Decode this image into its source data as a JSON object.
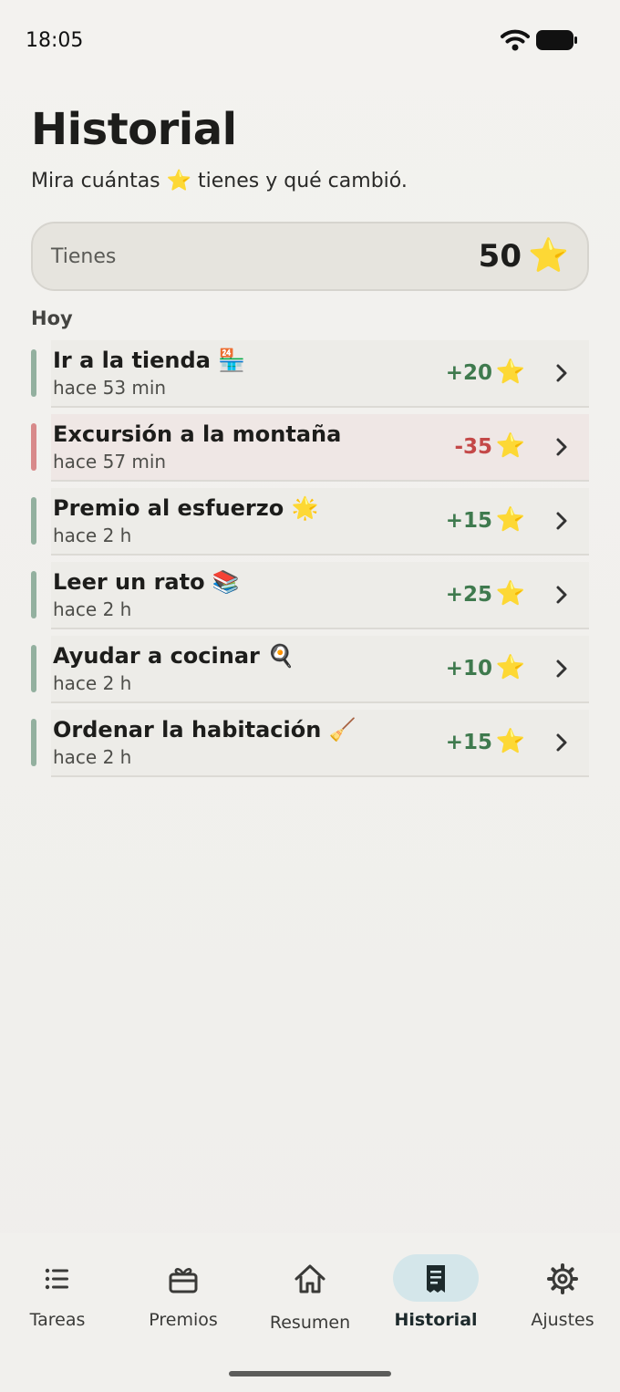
{
  "status": {
    "time": "18:05"
  },
  "header": {
    "title": "Historial",
    "subtitle": "Mira cuántas ⭐ tienes y qué cambió."
  },
  "balance": {
    "label": "Tienes",
    "value": "50",
    "star": "⭐"
  },
  "section": {
    "label": "Hoy"
  },
  "entries": [
    {
      "name": "Ir a la tienda 🏪",
      "time": "hace 53 min",
      "amount": "+20",
      "star": "⭐",
      "type": "positive"
    },
    {
      "name": "Excursión a la montaña",
      "time": "hace 57 min",
      "amount": "-35",
      "star": "⭐",
      "type": "negative"
    },
    {
      "name": "Premio al esfuerzo 🌟",
      "time": "hace 2 h",
      "amount": "+15",
      "star": "⭐",
      "type": "positive"
    },
    {
      "name": "Leer un rato 📚",
      "time": "hace 2 h",
      "amount": "+25",
      "star": "⭐",
      "type": "positive"
    },
    {
      "name": "Ayudar a cocinar 🍳",
      "time": "hace 2 h",
      "amount": "+10",
      "star": "⭐",
      "type": "positive"
    },
    {
      "name": "Ordenar la habitación 🧹",
      "time": "hace 2 h",
      "amount": "+15",
      "star": "⭐",
      "type": "positive"
    }
  ],
  "nav": {
    "items": [
      {
        "label": "Tareas",
        "icon": "list-icon"
      },
      {
        "label": "Premios",
        "icon": "gift-icon"
      },
      {
        "label": "Resumen",
        "icon": "home-icon"
      },
      {
        "label": "Historial",
        "icon": "receipt-icon",
        "active": true
      },
      {
        "label": "Ajustes",
        "icon": "gear-icon"
      }
    ]
  },
  "colors": {
    "positive": "#3f7a4e",
    "negative": "#c44848",
    "active_nav": "#d4e6ea",
    "star": "#f3c318"
  }
}
